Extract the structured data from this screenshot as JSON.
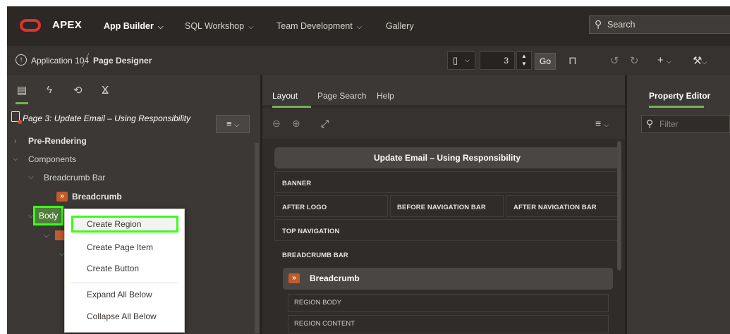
{
  "app": {
    "brand": "APEX",
    "nav": [
      {
        "label": "App Builder",
        "chevron": "⌵"
      },
      {
        "label": "SQL Workshop",
        "chevron": "⌵"
      },
      {
        "label": "Team Development",
        "chevron": "⌵"
      },
      {
        "label": "Gallery",
        "chevron": ""
      }
    ],
    "search_placeholder": "Search"
  },
  "toolbar": {
    "breadcrumb": [
      "Application 104",
      "Page Designer"
    ],
    "page_number": "3",
    "go_label": "Go"
  },
  "left_panel": {
    "page_header": "Page 3: Update Email – Using Responsibility",
    "tree": {
      "pre_rendering": "Pre-Rendering",
      "components": "Components",
      "breadcrumb_bar": "Breadcrumb Bar",
      "breadcrumb": "Breadcrumb",
      "body": "Body"
    }
  },
  "context_menu": {
    "items": [
      "Create Region",
      "Create Page Item",
      "Create Button",
      "Expand All Below",
      "Collapse All Below"
    ]
  },
  "middle_panel": {
    "tabs": [
      "Layout",
      "Page Search",
      "Help"
    ],
    "page_title": "Update Email – Using Responsibility",
    "slots": {
      "banner": "BANNER",
      "after_logo": "AFTER LOGO",
      "before_navigation_bar": "BEFORE NAVIGATION BAR",
      "after_navigation_bar": "AFTER NAVIGATION BAR",
      "top_navigation": "TOP NAVIGATION",
      "breadcrumb_bar": "BREADCRUMB BAR"
    },
    "breadcrumb_region": "Breadcrumb",
    "region_slots": [
      "REGION BODY",
      "REGION CONTENT"
    ]
  },
  "right_panel": {
    "tab": "Property Editor",
    "filter_placeholder": "Filter"
  },
  "colors": {
    "accent_green": "#78b154",
    "highlight": "#39ff14",
    "oracle_red": "#e0322b"
  }
}
